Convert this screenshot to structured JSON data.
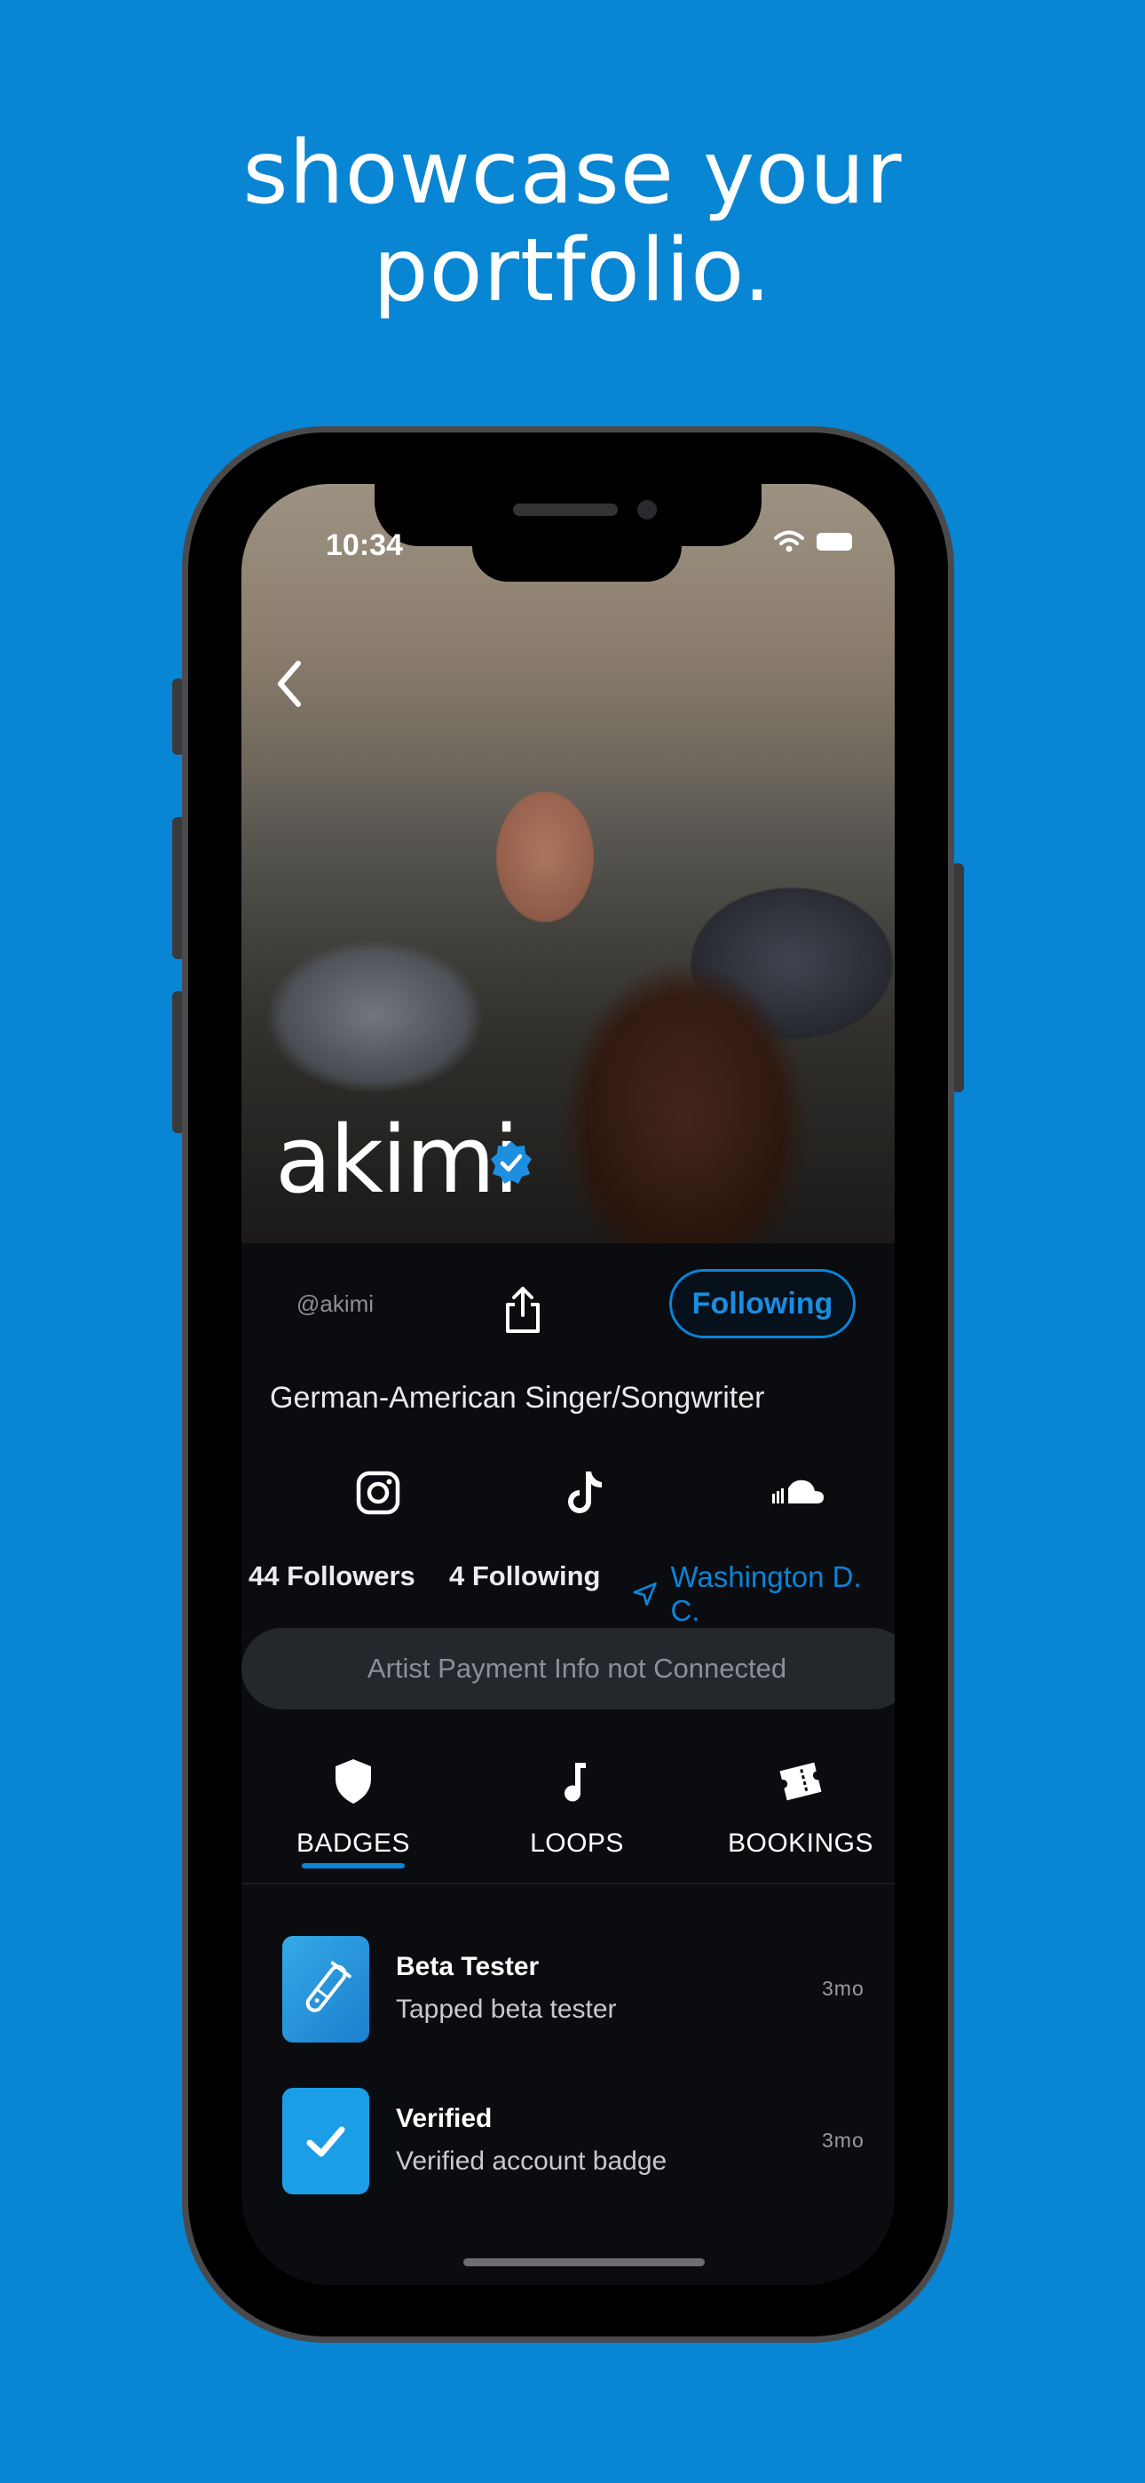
{
  "headline": {
    "line1": "showcase your",
    "line2": "portfolio."
  },
  "status_bar": {
    "time": "10:34"
  },
  "profile": {
    "name": "akimi",
    "handle": "@akimi",
    "follow_label": "Following",
    "bio": "German-American Singer/Songwriter",
    "socials": [
      "instagram-icon",
      "tiktok-icon",
      "soundcloud-icon"
    ],
    "followers": "44 Followers",
    "following": "4 Following",
    "location": "Washington D. C.",
    "payment_notice": "Artist Payment Info not Connected"
  },
  "tabs": [
    {
      "label": "BADGES",
      "icon": "shield-icon",
      "active": true
    },
    {
      "label": "LOOPS",
      "icon": "music-note-icon",
      "active": false
    },
    {
      "label": "BOOKINGS",
      "icon": "ticket-icon",
      "active": false
    }
  ],
  "badges": [
    {
      "title": "Beta Tester",
      "description": "Tapped beta tester",
      "time": "3mo",
      "icon": "test-tube-icon"
    },
    {
      "title": "Verified",
      "description": "Verified account badge",
      "time": "3mo",
      "icon": "checkmark-icon"
    }
  ],
  "colors": {
    "background": "#0885d3",
    "accent": "#0a84d8",
    "screen": "#0b0c0f"
  }
}
